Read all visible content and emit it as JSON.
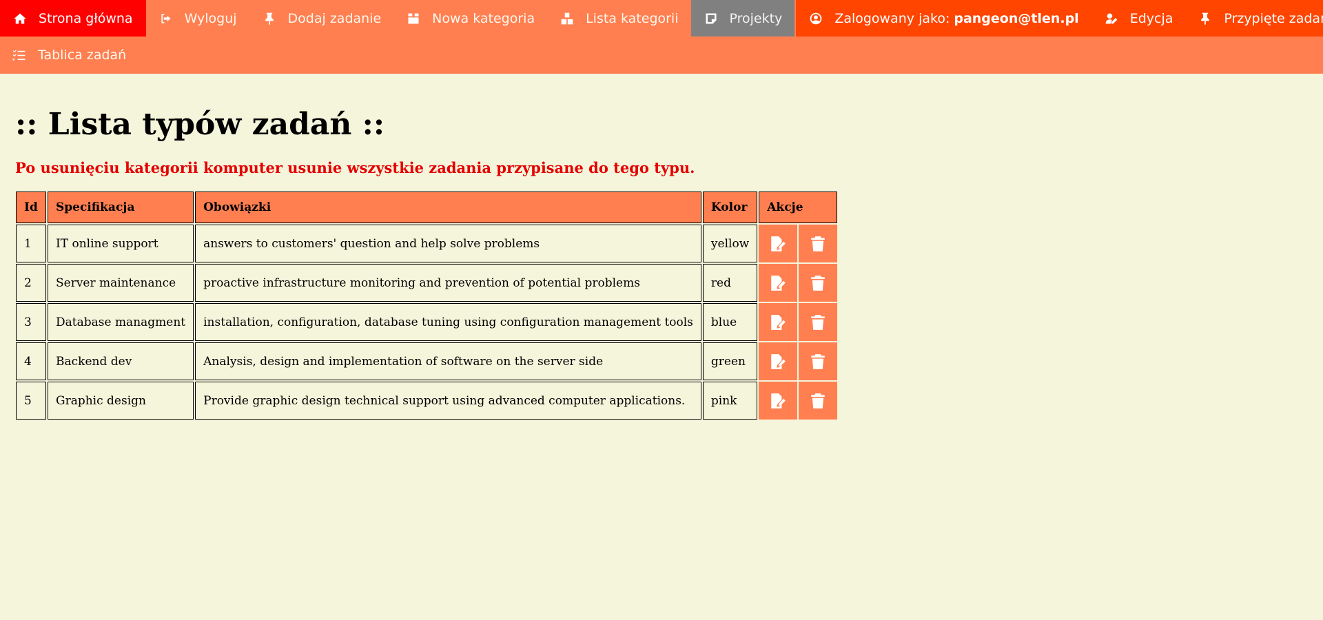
{
  "nav": {
    "row1": [
      {
        "label": "Strona główna",
        "icon": "home-icon"
      },
      {
        "label": "Wyloguj",
        "icon": "sign-out-icon"
      },
      {
        "label": "Dodaj zadanie",
        "icon": "pin-icon"
      },
      {
        "label": "Nowa kategoria",
        "icon": "box-icon"
      },
      {
        "label": "Lista kategorii",
        "icon": "boxes-icon"
      },
      {
        "label": "Projekty",
        "icon": "sticky-note-icon"
      }
    ],
    "user_prefix": "Zalogowany jako:",
    "user_email": "pangeon@tlen.pl",
    "edit_label": "Edycja",
    "pinned_label": "Przypięte zadania",
    "board_label": "Tablica zadań"
  },
  "page": {
    "title": ":: Lista typów zadań ::",
    "warning": "Po usunięciu kategorii komputer usunie wszystkie zadania przypisane do tego typu."
  },
  "table": {
    "headers": [
      "Id",
      "Specifikacja",
      "Obowiązki",
      "Kolor",
      "Akcje"
    ],
    "rows": [
      {
        "id": "1",
        "spec": "IT online support",
        "duties": "answers to customers' question and help solve problems",
        "color": "yellow"
      },
      {
        "id": "2",
        "spec": "Server maintenance",
        "duties": "proactive infrastructure monitoring and prevention of potential problems",
        "color": "red"
      },
      {
        "id": "3",
        "spec": "Database managment",
        "duties": "installation, configuration, database tuning using configuration management tools",
        "color": "blue"
      },
      {
        "id": "4",
        "spec": "Backend dev",
        "duties": "Analysis, design and implementation of software on the server side",
        "color": "green"
      },
      {
        "id": "5",
        "spec": "Graphic design",
        "duties": "Provide graphic design technical support using advanced computer applications.",
        "color": "pink"
      }
    ]
  },
  "colors": {
    "nav_bg": "#ff7f50",
    "home_bg": "#ff0000",
    "active_bg": "#808080",
    "user_bg": "#ff4500",
    "page_bg": "#f5f5dc",
    "warning": "#e50000"
  },
  "icons": {
    "edit": "edit-icon",
    "delete": "trash-icon"
  }
}
